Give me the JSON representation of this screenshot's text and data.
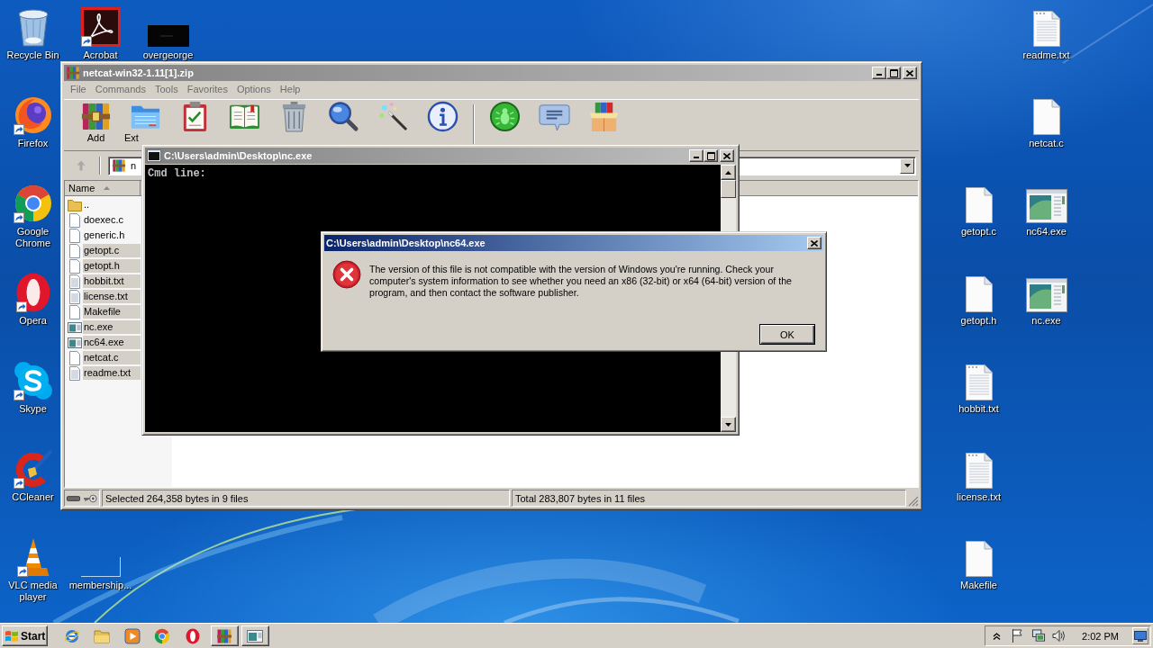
{
  "desktop_icons": [
    {
      "label": "Recycle Bin",
      "kind": "recycle-bin",
      "shortcut": false
    },
    {
      "label": "Firefox",
      "kind": "firefox",
      "shortcut": true
    },
    {
      "label": "Google Chrome",
      "kind": "chrome",
      "shortcut": true
    },
    {
      "label": "Opera",
      "kind": "opera",
      "shortcut": true
    },
    {
      "label": "Skype",
      "kind": "skype",
      "shortcut": true
    },
    {
      "label": "CCleaner",
      "kind": "ccleaner",
      "shortcut": true
    },
    {
      "label": "VLC media player",
      "kind": "vlc",
      "shortcut": true
    },
    {
      "label": "Acrobat",
      "kind": "acrobat",
      "shortcut": true
    },
    {
      "label": "overgeorge",
      "kind": "dark-thumbnail",
      "shortcut": false
    },
    {
      "label": "membership...",
      "kind": "blank-thumbnail",
      "shortcut": false
    },
    {
      "label": "readme.txt",
      "kind": "text-file",
      "shortcut": false
    },
    {
      "label": "netcat.c",
      "kind": "blank-file",
      "shortcut": false
    },
    {
      "label": "getopt.c",
      "kind": "blank-file",
      "shortcut": false
    },
    {
      "label": "nc64.exe",
      "kind": "program",
      "shortcut": false
    },
    {
      "label": "getopt.h",
      "kind": "blank-file",
      "shortcut": false
    },
    {
      "label": "nc.exe",
      "kind": "program",
      "shortcut": false
    },
    {
      "label": "hobbit.txt",
      "kind": "text-file",
      "shortcut": false
    },
    {
      "label": "license.txt",
      "kind": "text-file",
      "shortcut": false
    },
    {
      "label": "Makefile",
      "kind": "blank-file",
      "shortcut": false
    }
  ],
  "archive_window": {
    "title": "netcat-win32-1.11[1].zip",
    "active": false,
    "menu": [
      "File",
      "Commands",
      "Tools",
      "Favorites",
      "Options",
      "Help"
    ],
    "toolbar": [
      {
        "kind": "add",
        "label": "Add"
      },
      {
        "kind": "extract",
        "label": "Ext"
      },
      {
        "kind": "test"
      },
      {
        "kind": "view"
      },
      {
        "kind": "delete"
      },
      {
        "kind": "find"
      },
      {
        "kind": "wizard"
      },
      {
        "kind": "info"
      },
      {
        "kind": "separator"
      },
      {
        "kind": "scan"
      },
      {
        "kind": "comment"
      },
      {
        "kind": "sfx"
      }
    ],
    "up_button": {
      "disabled": true
    },
    "path": "n",
    "columns": [
      "Name"
    ],
    "files": [
      {
        "name": "..",
        "kind": "folder",
        "selected": false
      },
      {
        "name": "doexec.c",
        "kind": "file",
        "selected": false
      },
      {
        "name": "generic.h",
        "kind": "file",
        "selected": false
      },
      {
        "name": "getopt.c",
        "kind": "file",
        "selected": true
      },
      {
        "name": "getopt.h",
        "kind": "file",
        "selected": true
      },
      {
        "name": "hobbit.txt",
        "kind": "text",
        "selected": true
      },
      {
        "name": "license.txt",
        "kind": "text",
        "selected": true
      },
      {
        "name": "Makefile",
        "kind": "file",
        "selected": true
      },
      {
        "name": "nc.exe",
        "kind": "program",
        "selected": true
      },
      {
        "name": "nc64.exe",
        "kind": "program",
        "selected": true
      },
      {
        "name": "netcat.c",
        "kind": "file",
        "selected": true
      },
      {
        "name": "readme.txt",
        "kind": "text",
        "selected": true
      }
    ],
    "status": [
      "Selected 264,358 bytes in 9 files",
      "Total 283,807 bytes in 11 files"
    ]
  },
  "console_window": {
    "title": "C:\\Users\\admin\\Desktop\\nc.exe",
    "active": false,
    "lines": [
      "Cmd line:"
    ]
  },
  "error_dialog": {
    "title": "C:\\Users\\admin\\Desktop\\nc64.exe",
    "active": true,
    "message": "The version of this file is not compatible with the version of Windows you're running. Check your computer's system information to see whether you need an x86 (32-bit) or x64 (64-bit) version of the program, and then contact the software publisher.",
    "buttons": [
      {
        "label": "OK",
        "default": true
      }
    ]
  },
  "taskbar": {
    "start_label": "Start",
    "quick_launch": [
      {
        "kind": "browser"
      },
      {
        "kind": "folder"
      },
      {
        "kind": "media"
      },
      {
        "kind": "chrome"
      },
      {
        "kind": "opera"
      }
    ],
    "tasks": [
      {
        "kind": "archive"
      },
      {
        "kind": "console"
      }
    ],
    "tray": [
      {
        "kind": "chevron"
      },
      {
        "kind": "flag"
      },
      {
        "kind": "network"
      },
      {
        "kind": "speaker"
      }
    ],
    "clock": "2:02 PM"
  }
}
